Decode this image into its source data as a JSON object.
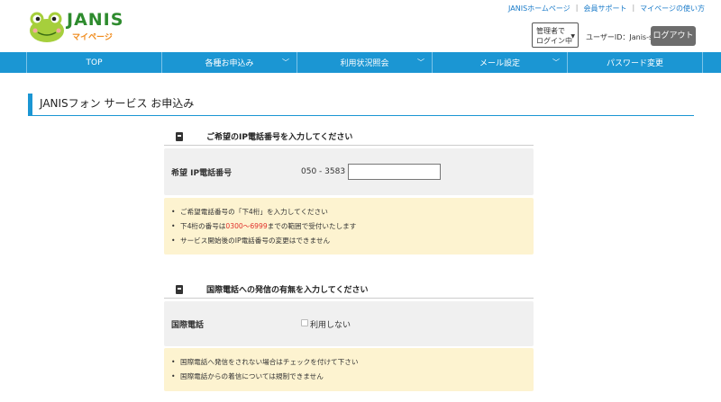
{
  "logo": {
    "title": "JANIS",
    "subtitle": "マイページ"
  },
  "top_links": [
    "JANISホームページ",
    "会員サポート",
    "マイページの使い方"
  ],
  "admin_badge": {
    "line1": "管理者で",
    "line2": "ログイン中"
  },
  "user_id": "ユーザーID：Janis-spt",
  "logout_label": "ログアウト",
  "nav": [
    {
      "label": "TOP",
      "has_menu": false
    },
    {
      "label": "各種お申込み",
      "has_menu": true
    },
    {
      "label": "利用状況照会",
      "has_menu": true
    },
    {
      "label": "メール設定",
      "has_menu": true
    },
    {
      "label": "パスワード変更",
      "has_menu": false
    }
  ],
  "page_title": "JANISフォン サービス お申込み",
  "section1": {
    "heading": "ご希望のIP電話番号を入力してください",
    "field_label": "希望 IP電話番号",
    "prefix": "050 - 3583 -",
    "input_value": "",
    "notes": {
      "n1": "ご希望電話番号の「下4桁」を入力してください",
      "n2_pre": "下4桁の番号は",
      "n2_range": "0300〜6999",
      "n2_post": "までの範囲で受付いたします",
      "n3": "サービス開始後のIP電話番号の変更はできません"
    }
  },
  "section2": {
    "heading": "国際電話への発信の有無を入力してください",
    "field_label": "国際電話",
    "checkbox_label": "利用しない",
    "checked": false,
    "notes": {
      "n1": "国際電話へ発信をされない場合はチェックを付けて下さい",
      "n2": "国際電話からの着信については規制できません"
    }
  },
  "colors": {
    "accent": "#1b96d3",
    "note_bg": "#fdf3d0",
    "field_bg": "#f0f0f0",
    "logout_bg": "#6d6d6d"
  }
}
